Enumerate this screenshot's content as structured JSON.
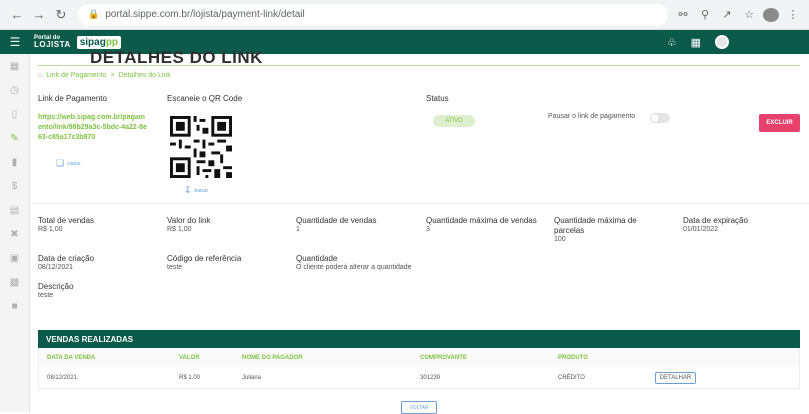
{
  "browser": {
    "url": "portal.sippe.com.br/lojista/payment-link/detail"
  },
  "header": {
    "brand_small_top": "Portal do",
    "brand_small_bottom": "LOJISTA",
    "brand_logo_a": "sipag",
    "brand_logo_b": "pp"
  },
  "page": {
    "title": "DETALHES DO LINK",
    "breadcrumb": [
      "Link de Pagamento",
      ">",
      "Detalhes do Link"
    ]
  },
  "link": {
    "label": "Link de Pagamento",
    "url": "https://web.sipag.com.br/pagamento/link/98b29a3c-5bdc-4a22-8e63-c85a17c3b870",
    "copy_label": "copiar"
  },
  "qr": {
    "label": "Escaneie o QR Code",
    "download_label": "baixar"
  },
  "status": {
    "label": "Status",
    "value": "ATIVO",
    "pause_label": "Pausar o link de pagamento",
    "delete_label": "EXCLUIR"
  },
  "fields": {
    "total_vendas_label": "Total de vendas",
    "total_vendas_value": "R$ 1,00",
    "valor_link_label": "Valor do link",
    "valor_link_value": "R$ 1,00",
    "qtd_vendas_label": "Quantidade de vendas",
    "qtd_vendas_value": "1",
    "qtd_max_vendas_label": "Quantidade máxima de vendas",
    "qtd_max_vendas_value": "3",
    "qtd_max_parcelas_label": "Quantidade máxima de parcelas",
    "qtd_max_parcelas_value": "100",
    "data_expiracao_label": "Data de expiração",
    "data_expiracao_value": "01/01/2022",
    "data_criacao_label": "Data de criação",
    "data_criacao_value": "08/12/2021",
    "codigo_ref_label": "Código de referência",
    "codigo_ref_value": "teste",
    "quantidade_label": "Quantidade",
    "quantidade_value": "O cliente poderá alterar a quantidade",
    "descricao_label": "Descrição",
    "descricao_value": "teste"
  },
  "sales": {
    "title": "VENDAS REALIZADAS",
    "columns": [
      "DATA DA VENDA",
      "VALOR",
      "NOME DO PAGADOR",
      "COMPROVANTE",
      "PRODUTO"
    ],
    "rows": [
      {
        "data": "08/12/2021",
        "valor": "R$ 1,00",
        "nome": "Juliana",
        "comprovante": "301239",
        "produto": "CRÉDITO",
        "action": "DETALHAR"
      }
    ],
    "back_label": "VOLTAR"
  }
}
